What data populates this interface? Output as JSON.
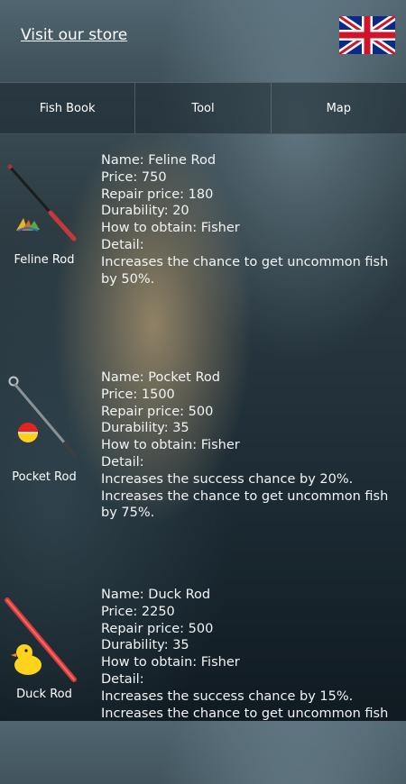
{
  "header": {
    "store_link": "Visit our store",
    "flag_icon": "uk-flag-icon"
  },
  "tabs": [
    {
      "label": "Fish Book"
    },
    {
      "label": "Tool"
    },
    {
      "label": "Map"
    }
  ],
  "rods": [
    {
      "caption": "Feline Rod",
      "icon": "feline-rod-icon",
      "name": "Name: Feline Rod",
      "price": "Price: 750",
      "repair": "Repair price: 180",
      "durability": "Durability: 20",
      "obtain": "How to obtain: Fisher",
      "detail_label": "Detail:",
      "detail_1": "Increases the chance to get uncommon fish by 50%.",
      "detail_2": ""
    },
    {
      "caption": "Pocket Rod",
      "icon": "pocket-rod-icon",
      "name": "Name: Pocket Rod",
      "price": "Price: 1500",
      "repair": "Repair price: 500",
      "durability": "Durability: 35",
      "obtain": "How to obtain: Fisher",
      "detail_label": "Detail:",
      "detail_1": "Increases the success chance by 20%.",
      "detail_2": "Increases the chance to get uncommon fish by 75%."
    },
    {
      "caption": "Duck Rod",
      "icon": "duck-rod-icon",
      "name": "Name: Duck Rod",
      "price": "Price: 2250",
      "repair": "Repair price: 500",
      "durability": "Durability: 35",
      "obtain": "How to obtain: Fisher",
      "detail_label": "Detail:",
      "detail_1": "Increases the success chance by 15%.",
      "detail_2": "Increases the chance to get uncommon fish"
    }
  ]
}
